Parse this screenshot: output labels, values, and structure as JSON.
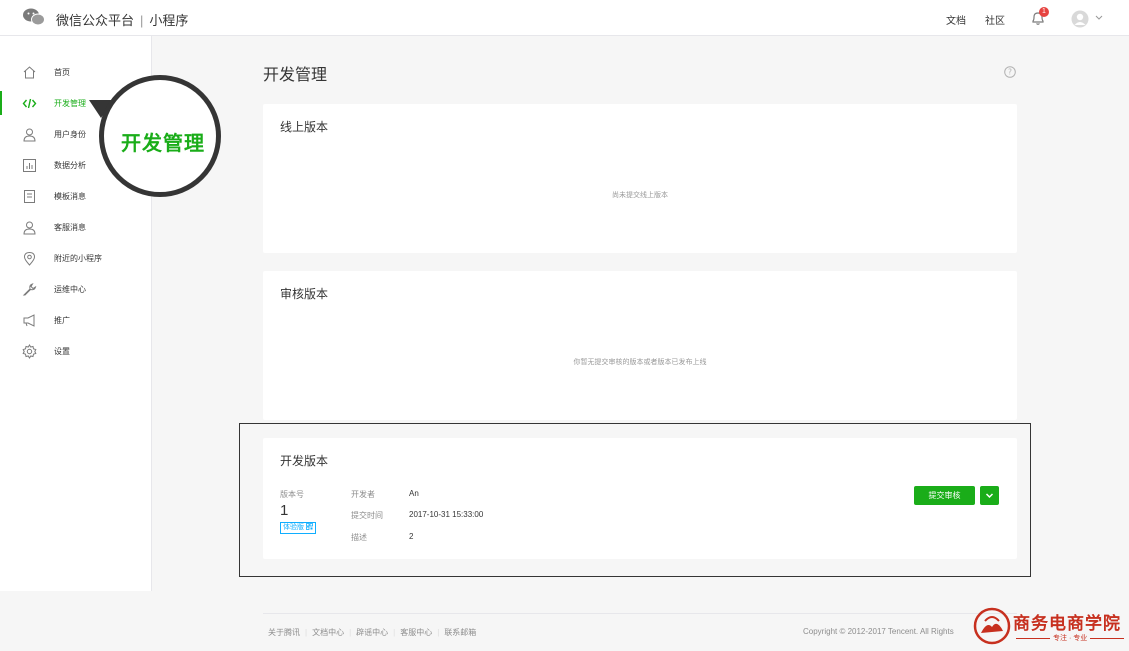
{
  "header": {
    "brand": "微信公众平台",
    "separator": "|",
    "section": "小程序",
    "links": {
      "docs": "文档",
      "community": "社区"
    },
    "notification_count": "1"
  },
  "sidebar": {
    "items": [
      {
        "label": "首页",
        "icon": "home-icon"
      },
      {
        "label": "开发管理",
        "icon": "code-icon",
        "active": true
      },
      {
        "label": "用户身份",
        "icon": "user-icon"
      },
      {
        "label": "数据分析",
        "icon": "chart-icon"
      },
      {
        "label": "模板消息",
        "icon": "template-icon"
      },
      {
        "label": "客服消息",
        "icon": "service-icon"
      },
      {
        "label": "附近的小程序",
        "icon": "location-icon"
      },
      {
        "label": "运维中心",
        "icon": "wrench-icon"
      },
      {
        "label": "推广",
        "icon": "megaphone-icon"
      },
      {
        "label": "设置",
        "icon": "gear-icon"
      }
    ]
  },
  "callout": {
    "text": "开发管理"
  },
  "main": {
    "title": "开发管理",
    "online": {
      "title": "线上版本",
      "empty": "尚未提交线上版本"
    },
    "review": {
      "title": "审核版本",
      "empty": "你暂无提交审核的版本或者版本已发布上线"
    },
    "dev": {
      "title": "开发版本",
      "version_label": "版本号",
      "version": "1",
      "tag": "体验版 ",
      "developer_label": "开发者",
      "developer": "An",
      "submit_time_label": "提交时间",
      "submit_time": "2017-10-31 15:33:00",
      "desc_label": "描述",
      "desc": "2",
      "submit_button": "提交审核"
    }
  },
  "footer": {
    "links": [
      "关于腾讯",
      "文档中心",
      "辟谣中心",
      "客服中心",
      "联系邮箱"
    ],
    "copyright": "Copyright © 2012-2017 Tencent. All Rights"
  },
  "watermark": {
    "title": "商务电商学院",
    "subtitle": "专注 · 专业"
  },
  "colors": {
    "accent": "#1aad19",
    "badge": "#e64340",
    "tag": "#10aeff",
    "watermark": "#c7301f"
  }
}
